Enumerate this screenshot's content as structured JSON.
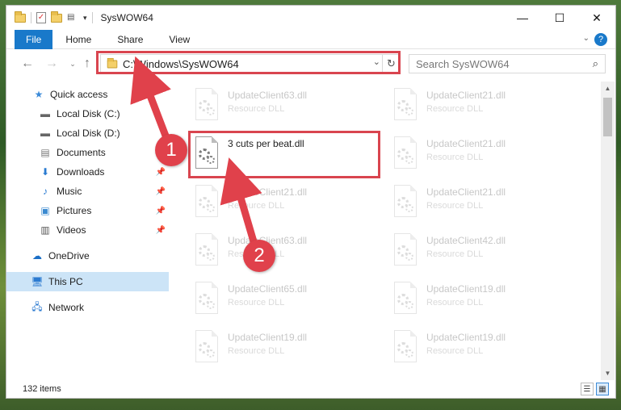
{
  "window": {
    "title": "SysWOW64",
    "controls": {
      "minimize": "—",
      "maximize": "☐",
      "close": "✕"
    }
  },
  "ribbon": {
    "tabs": [
      "File",
      "Home",
      "Share",
      "View"
    ],
    "help": "?"
  },
  "address": {
    "path": "C:\\Windows\\SysWOW64",
    "search_placeholder": "Search SysWOW64"
  },
  "sidebar": {
    "items": [
      {
        "label": "Quick access",
        "icon": "star-icon"
      },
      {
        "label": "Local Disk (C:)",
        "icon": "drive-icon"
      },
      {
        "label": "Local Disk (D:)",
        "icon": "drive-icon"
      },
      {
        "label": "Documents",
        "icon": "documents-icon"
      },
      {
        "label": "Downloads",
        "icon": "downloads-icon"
      },
      {
        "label": "Music",
        "icon": "music-icon"
      },
      {
        "label": "Pictures",
        "icon": "pictures-icon"
      },
      {
        "label": "Videos",
        "icon": "videos-icon"
      },
      {
        "label": "OneDrive",
        "icon": "cloud-icon"
      },
      {
        "label": "This PC",
        "icon": "computer-icon"
      },
      {
        "label": "Network",
        "icon": "network-icon"
      }
    ]
  },
  "files": [
    {
      "name": "UpdateClient63.dll",
      "type": "Resource DLL"
    },
    {
      "name": "UpdateClient21.dll",
      "type": "Resource DLL"
    },
    {
      "name": "3 cuts per beat.dll",
      "type": ""
    },
    {
      "name": "UpdateClient21.dll",
      "type": "Resource DLL"
    },
    {
      "name": "UpdateClient21.dll",
      "type": "Resource DLL"
    },
    {
      "name": "UpdateClient21.dll",
      "type": "Resource DLL"
    },
    {
      "name": "UpdateClient63.dll",
      "type": "Resource DLL"
    },
    {
      "name": "UpdateClient42.dll",
      "type": "Resource DLL"
    },
    {
      "name": "UpdateClient65.dll",
      "type": "Resource DLL"
    },
    {
      "name": "UpdateClient19.dll",
      "type": "Resource DLL"
    },
    {
      "name": "UpdateClient19.dll",
      "type": "Resource DLL"
    },
    {
      "name": "UpdateClient19.dll",
      "type": "Resource DLL"
    }
  ],
  "status": {
    "item_count": "132 items"
  },
  "annotations": {
    "marker1": "1",
    "marker2": "2",
    "accent": "#d9454f"
  }
}
